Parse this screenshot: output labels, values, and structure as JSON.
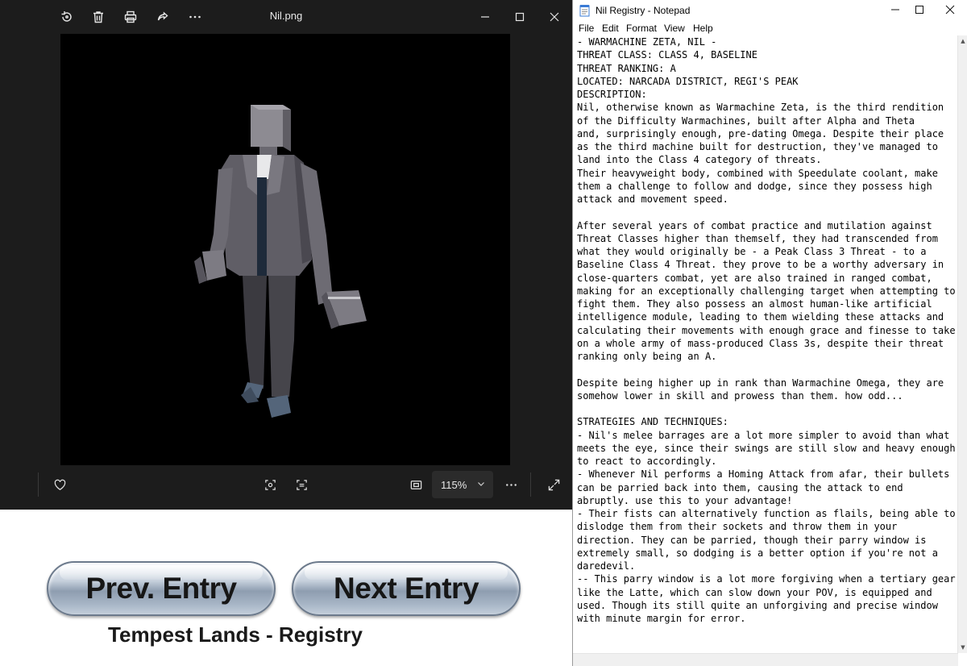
{
  "viewer": {
    "title": "Nil.png",
    "toolbar_icons": [
      "rotate-icon",
      "delete-icon",
      "print-icon",
      "share-icon",
      "more-icon"
    ],
    "zoom": "115%"
  },
  "registry": {
    "prev_label": "Prev. Entry",
    "next_label": "Next Entry",
    "footer": "Tempest Lands - Registry"
  },
  "notepad": {
    "title": "Nil Registry - Notepad",
    "menu": [
      "File",
      "Edit",
      "Format",
      "View",
      "Help"
    ],
    "lines": [
      "- WARMACHINE ZETA, NIL -",
      "THREAT CLASS: CLASS 4, BASELINE",
      "THREAT RANKING: A",
      "LOCATED: NARCADA DISTRICT, REGI'S PEAK",
      "DESCRIPTION:",
      "Nil, otherwise known as Warmachine Zeta, is the third rendition",
      "of the Difficulty Warmachines, built after Alpha and Theta",
      "and, surprisingly enough, pre-dating Omega. Despite their place",
      "as the third machine built for destruction, they've managed to",
      "land into the Class 4 category of threats.",
      "Their heavyweight body, combined with Speedulate coolant, make",
      "them a challenge to follow and dodge, since they possess high",
      "attack and movement speed.",
      "",
      "After several years of combat practice and mutilation against",
      "Threat Classes higher than themself, they had transcended from",
      "what they would originally be - a Peak Class 3 Threat - to a",
      "Baseline Class 4 Threat. they prove to be a worthy adversary in",
      "close-quarters combat, yet are also trained in ranged combat,",
      "making for an exceptionally challenging target when attempting to",
      "fight them. They also possess an almost human-like artificial",
      "intelligence module, leading to them wielding these attacks and",
      "calculating their movements with enough grace and finesse to take",
      "on a whole army of mass-produced Class 3s, despite their threat",
      "ranking only being an A.",
      "",
      "Despite being higher up in rank than Warmachine Omega, they are",
      "somehow lower in skill and prowess than them. how odd...",
      "",
      "STRATEGIES AND TECHNIQUES:",
      "- Nil's melee barrages are a lot more simpler to avoid than what",
      "meets the eye, since their swings are still slow and heavy enough",
      "to react to accordingly.",
      "- Whenever Nil performs a Homing Attack from afar, their bullets",
      "can be parried back into them, causing the attack to end",
      "abruptly. use this to your advantage!",
      "- Their fists can alternatively function as flails, being able to",
      "dislodge them from their sockets and throw them in your",
      "direction. They can be parried, though their parry window is",
      "extremely small, so dodging is a better option if you're not a",
      "daredevil.",
      "-- This parry window is a lot more forgiving when a tertiary gear",
      "like the Latte, which can slow down your POV, is equipped and",
      "used. Though its still quite an unforgiving and precise window",
      "with minute margin for error."
    ]
  }
}
